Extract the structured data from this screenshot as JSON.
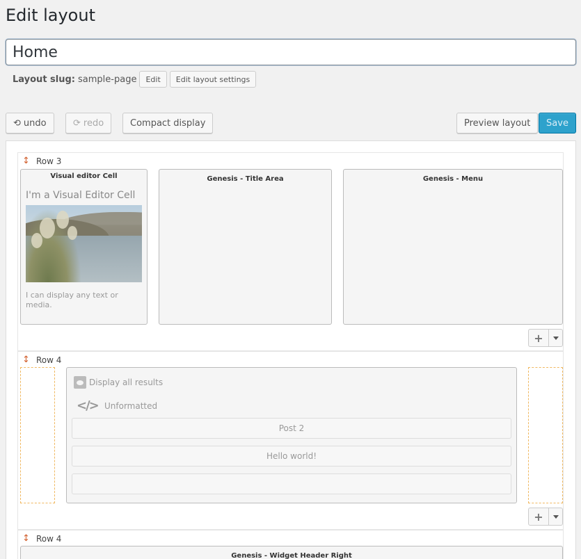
{
  "page": {
    "title": "Edit layout"
  },
  "layout": {
    "name": "Home",
    "slug_label": "Layout slug:",
    "slug_value": "sample-page",
    "edit_label": "Edit",
    "settings_label": "Edit layout settings"
  },
  "toolbar": {
    "undo_label": "undo",
    "redo_label": "redo",
    "compact_label": "Compact display",
    "preview_label": "Preview layout",
    "save_label": "Save"
  },
  "rows": [
    {
      "label": "Row 3",
      "cells": [
        {
          "title": "Visual editor Cell",
          "heading": "I'm a Visual Editor Cell",
          "text": "I can display any text or media."
        },
        {
          "title": "Genesis - Title Area"
        },
        {
          "title": "Genesis - Menu"
        }
      ]
    },
    {
      "label": "Row 4",
      "view": {
        "line1": "Display all results",
        "line2": "Unformatted",
        "items": [
          "Post 2",
          "Hello world!",
          ""
        ]
      }
    },
    {
      "label": "Row 4",
      "cells": [
        {
          "title": "Genesis - Widget Header Right"
        }
      ]
    }
  ],
  "icons": {
    "undo": "undo-icon",
    "redo": "redo-icon",
    "move": "move-row-icon",
    "add": "plus-icon",
    "dropdown": "caret-down-icon",
    "view": "calendar-eye-icon",
    "code": "code-icon"
  },
  "colors": {
    "save_bg": "#2ea2cc",
    "move_icon": "#d2602e",
    "placeholder_border": "#f0b860"
  }
}
